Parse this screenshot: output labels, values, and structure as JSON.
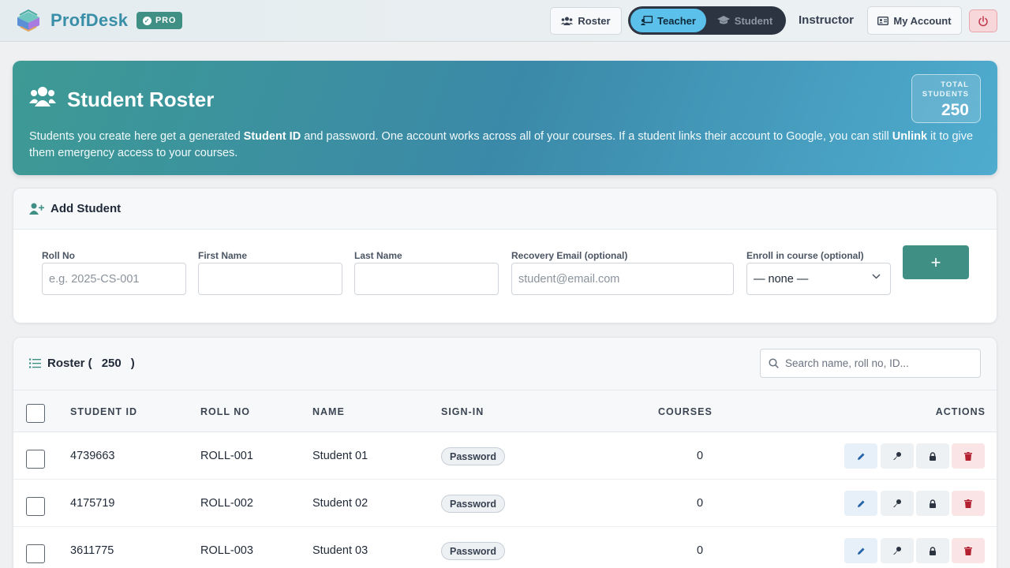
{
  "topbar": {
    "brand": "ProfDesk",
    "badge": "PRO",
    "roster_button": "Roster",
    "mode": {
      "teacher": "Teacher",
      "student": "Student",
      "active": "Teacher"
    },
    "role": "Instructor",
    "account_button": "My Account",
    "accent_color": "#3a8fa8"
  },
  "hero": {
    "title": "Student Roster",
    "desc_1": "Students you create here get a generated ",
    "desc_bold_1": "Student ID",
    "desc_2": " and password. One account works across all of your courses. If a student links their account to Google, you can still ",
    "desc_bold_2": "Unlink",
    "desc_3": " it to give them emergency access to your courses.",
    "total_label_1": "TOTAL",
    "total_label_2": "STUDENTS",
    "total_value": "250"
  },
  "add_student": {
    "title": "Add Student",
    "fields": {
      "roll_no": {
        "label": "Roll No",
        "placeholder": "e.g. 2025-CS-001",
        "value": ""
      },
      "first_name": {
        "label": "First Name",
        "placeholder": "",
        "value": ""
      },
      "last_name": {
        "label": "Last Name",
        "placeholder": "",
        "value": ""
      },
      "recovery_email": {
        "label": "Recovery Email (optional)",
        "placeholder": "student@email.com",
        "value": ""
      },
      "enroll": {
        "label": "Enroll in course (optional)",
        "value": "— none —"
      }
    },
    "add_button": "+"
  },
  "roster": {
    "title": "Roster (",
    "count": "250",
    "title_close": ")",
    "search_placeholder": "Search name, roll no, ID...",
    "columns": [
      "STUDENT ID",
      "ROLL NO",
      "NAME",
      "SIGN-IN",
      "COURSES",
      "ACTIONS"
    ],
    "rows": [
      {
        "student_id": "4739663",
        "roll_no": "ROLL-001",
        "name": "Student 01",
        "signin": "Password",
        "courses": "0"
      },
      {
        "student_id": "4175719",
        "roll_no": "ROLL-002",
        "name": "Student 02",
        "signin": "Password",
        "courses": "0"
      },
      {
        "student_id": "3611775",
        "roll_no": "ROLL-003",
        "name": "Student 03",
        "signin": "Password",
        "courses": "0"
      }
    ]
  }
}
